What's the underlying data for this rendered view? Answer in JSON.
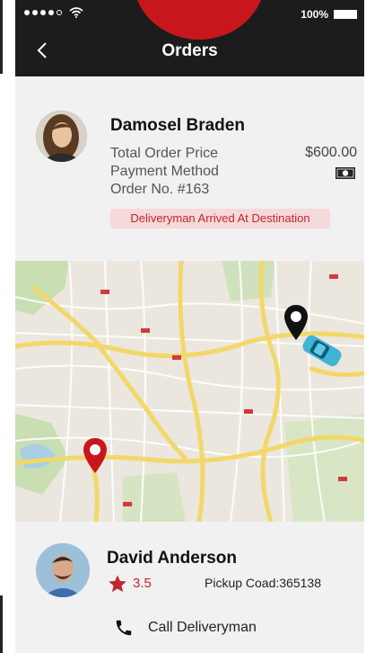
{
  "status_bar": {
    "battery_percent": "100%",
    "signal_dots": 5
  },
  "header": {
    "title": "Orders",
    "back_icon": "chevron-left-icon",
    "background": "#1c1c1c",
    "accent": "#c8161d"
  },
  "order": {
    "customer_name": "Damosel Braden",
    "total_label": "Total Order Price",
    "total_value": "$600.00",
    "payment_label": "Payment Method",
    "payment_icon": "cash-icon",
    "order_no": "Order No. #163",
    "status_badge": "Deliveryman Arrived At Destination",
    "status_color": "#c0262d"
  },
  "map": {
    "pickup_marker_icon": "location-pin-black-icon",
    "destination_marker_icon": "location-pin-red-icon",
    "vehicle_icon": "car-icon"
  },
  "deliveryman": {
    "name": "David Anderson",
    "rating": "3.5",
    "pickup_code": "Pickup Coad:365138",
    "call_label": "Call Deliveryman",
    "call_icon": "phone-icon"
  }
}
